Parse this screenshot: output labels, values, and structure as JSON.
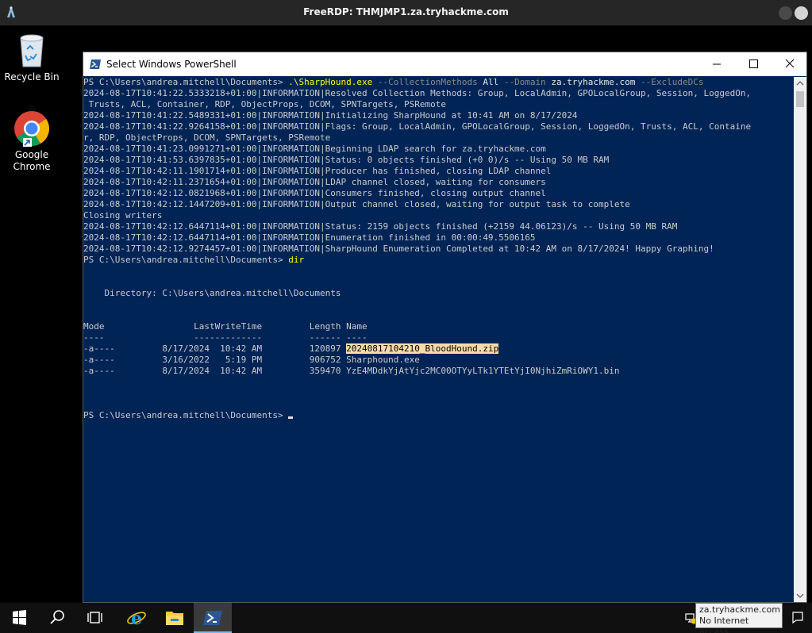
{
  "rdp": {
    "title": "FreeRDP: THMJMP1.za.tryhackme.com"
  },
  "desktop": {
    "icons": [
      {
        "label": "Recycle Bin"
      },
      {
        "label_line1": "Google",
        "label_line2": "Chrome"
      }
    ]
  },
  "window": {
    "title": "Select Windows PowerShell"
  },
  "console": {
    "prompt1": "PS C:\\Users\\andrea.mitchell\\Documents> ",
    "cmd_exe": ".\\SharpHound.exe",
    "cmd_p1": " --CollectionMethods",
    "cmd_v1": " All",
    "cmd_p2": " --Domain",
    "cmd_v2": " za.tryhackme.com",
    "cmd_p3": " --ExcludeDCs",
    "lines": [
      "2024-08-17T10:41:22.5333218+01:00|INFORMATION|Resolved Collection Methods: Group, LocalAdmin, GPOLocalGroup, Session, LoggedOn,",
      " Trusts, ACL, Container, RDP, ObjectProps, DCOM, SPNTargets, PSRemote",
      "2024-08-17T10:41:22.5489331+01:00|INFORMATION|Initializing SharpHound at 10:41 AM on 8/17/2024",
      "2024-08-17T10:41:22.9264158+01:00|INFORMATION|Flags: Group, LocalAdmin, GPOLocalGroup, Session, LoggedOn, Trusts, ACL, Containe",
      "r, RDP, ObjectProps, DCOM, SPNTargets, PSRemote",
      "2024-08-17T10:41:23.0991271+01:00|INFORMATION|Beginning LDAP search for za.tryhackme.com",
      "2024-08-17T10:41:53.6397835+01:00|INFORMATION|Status: 0 objects finished (+0 0)/s -- Using 50 MB RAM",
      "2024-08-17T10:42:11.1901714+01:00|INFORMATION|Producer has finished, closing LDAP channel",
      "2024-08-17T10:42:11.2371654+01:00|INFORMATION|LDAP channel closed, waiting for consumers",
      "2024-08-17T10:42:12.0821968+01:00|INFORMATION|Consumers finished, closing output channel",
      "2024-08-17T10:42:12.1447209+01:00|INFORMATION|Output channel closed, waiting for output task to complete",
      "Closing writers",
      "2024-08-17T10:42:12.6447114+01:00|INFORMATION|Status: 2159 objects finished (+2159 44.06123)/s -- Using 50 MB RAM",
      "2024-08-17T10:42:12.6447114+01:00|INFORMATION|Enumeration finished in 00:00:49.5506165",
      "2024-08-17T10:42:12.9274457+01:00|INFORMATION|SharpHound Enumeration Completed at 10:42 AM on 8/17/2024! Happy Graphing!"
    ],
    "prompt2": "PS C:\\Users\\andrea.mitchell\\Documents> ",
    "cmd2": "dir",
    "directory_line": "    Directory: C:\\Users\\andrea.mitchell\\Documents",
    "header_line": "Mode                 LastWriteTime         Length Name",
    "divider_line": "----                 -------------         ------ ----",
    "files": [
      {
        "prefix": "-a----         8/17/2024  10:42 AM         120897 ",
        "name": "20240817104210_BloodHound.zip"
      },
      {
        "prefix": "-a----         3/16/2022   5:19 PM         906752 ",
        "name": "Sharphound.exe"
      },
      {
        "prefix": "-a----         8/17/2024  10:42 AM         359470 ",
        "name": "YzE4MDdkYjAtYjc2MC00OTYyLTk1YTEtYjI0NjhiZmRiOWY1.bin"
      }
    ],
    "prompt3": "PS C:\\Users\\andrea.mitchell\\Documents> "
  },
  "tray": {
    "tooltip_line1": "za.tryhackme.com",
    "tooltip_line2": "No Internet access"
  },
  "colors": {
    "console_bg": "#012456",
    "console_text": "#cccccc",
    "command_yellow": "#ffff00",
    "param_gray": "#8a8a8a",
    "highlight": "#f7dcaa"
  },
  "icons": {
    "rdp_logo": "freerdp-logo-icon",
    "recycle_bin": "recycle-bin-icon",
    "chrome": "chrome-icon",
    "start": "windows-start-icon",
    "search": "search-icon",
    "task_view": "task-view-icon",
    "ie": "internet-explorer-icon",
    "explorer": "file-explorer-icon",
    "powershell": "powershell-icon",
    "network": "network-warning-icon"
  }
}
